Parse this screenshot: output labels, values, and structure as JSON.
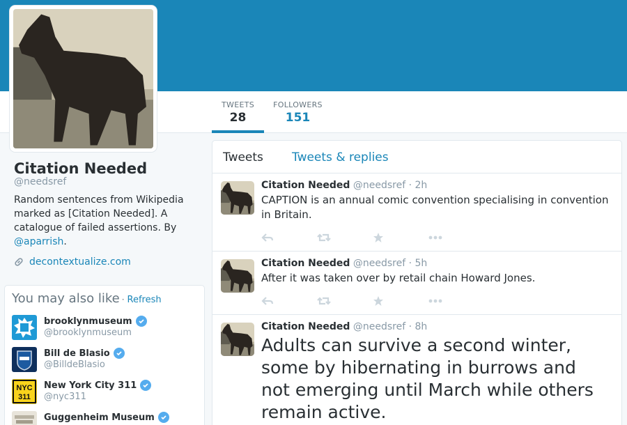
{
  "profile": {
    "name": "Citation Needed",
    "handle": "@needsref",
    "bio_text": "Random sentences from Wikipedia marked as [Citation Needed]. A catalogue of failed assertions. By ",
    "bio_link": "@aparrish",
    "bio_end": ".",
    "website": "decontextualize.com"
  },
  "stats": {
    "tweets_label": "TWEETS",
    "tweets_value": "28",
    "followers_label": "FOLLOWERS",
    "followers_value": "151"
  },
  "tabs": {
    "tweets": "Tweets",
    "replies": "Tweets & replies"
  },
  "tweets": [
    {
      "name": "Citation Needed",
      "handle": "@needsref",
      "dot": "·",
      "time": "2h",
      "text": "CAPTION is an annual comic convention specialising in convention in Britain."
    },
    {
      "name": "Citation Needed",
      "handle": "@needsref",
      "dot": "·",
      "time": "5h",
      "text": "After it was taken over by retail chain Howard Jones."
    },
    {
      "name": "Citation Needed",
      "handle": "@needsref",
      "dot": "·",
      "time": "8h",
      "text": "Adults can survive a second winter, some by hibernating in burrows and not emerging until March while others remain active."
    }
  ],
  "wtf": {
    "title": "You may also like",
    "dot": "·",
    "refresh": "Refresh",
    "users": [
      {
        "name": "brooklynmuseum",
        "handle": "@brooklynmuseum",
        "icon": "brooklyn-museum-logo"
      },
      {
        "name": "Bill de Blasio",
        "handle": "@BilldeBlasio",
        "icon": "nyc-badge"
      },
      {
        "name": "New York City 311",
        "handle": "@nyc311",
        "icon": "nyc-311-logo",
        "logo_text": "NYC\n311"
      },
      {
        "name": "Guggenheim Museum",
        "handle": "",
        "icon": "guggenheim-logo"
      }
    ]
  },
  "colors": {
    "accent": "#1a86b8",
    "verified": "#55acee",
    "nyc311_yellow": "#f8d31c"
  }
}
